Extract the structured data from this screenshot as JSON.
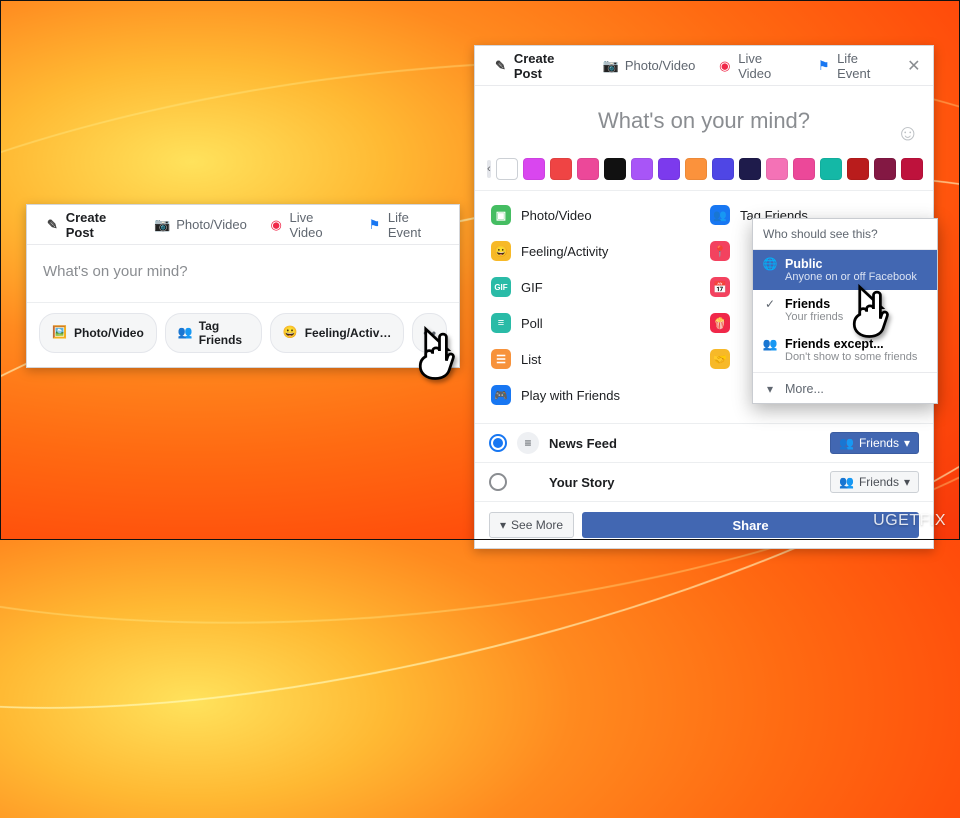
{
  "tabs": {
    "create": "Create Post",
    "photo": "Photo/Video",
    "live": "Live Video",
    "life": "Life Event"
  },
  "prompt": "What's on your mind?",
  "chips": {
    "photo": "Photo/Video",
    "tag": "Tag Friends",
    "feel": "Feeling/Activ…",
    "more": "•••"
  },
  "swatches": [
    "#ffffff",
    "#d946ef",
    "#ef4444",
    "#ec4899",
    "#111111",
    "#a855f7",
    "#7c3aed",
    "#fb923c",
    "#4f46e5",
    "#1e1b4b",
    "#f472b6",
    "#ec4899",
    "#14b8a6",
    "#b91c1c",
    "#831843",
    "#be123c"
  ],
  "opts": {
    "photo": "Photo/Video",
    "feel": "Feeling/Activity",
    "gif": "GIF",
    "poll": "Poll",
    "list": "List",
    "play": "Play with Friends",
    "tag": "Tag Friends"
  },
  "opt_icons": {
    "checkin": "#f3425f",
    "date": "#f7b928",
    "rec": "#f02849",
    "support": "#f7b928"
  },
  "dest": {
    "news": "News Feed",
    "story": "Your Story",
    "friends": "Friends"
  },
  "bottom": {
    "seemore": "See More",
    "share": "Share"
  },
  "popover": {
    "title": "Who should see this?",
    "public": {
      "t": "Public",
      "d": "Anyone on or off Facebook"
    },
    "friends": {
      "t": "Friends",
      "d": "Your friends"
    },
    "except": {
      "t": "Friends except...",
      "d": "Don't show to some friends"
    },
    "more": "More..."
  },
  "watermark": "UGETFIX"
}
